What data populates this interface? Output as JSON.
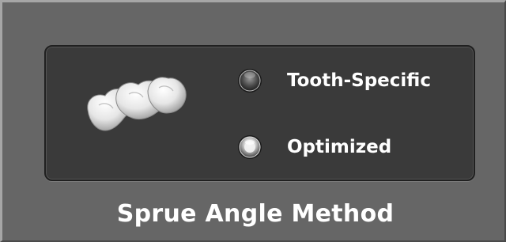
{
  "options": [
    {
      "label": "Tooth-Specific",
      "selected": false
    },
    {
      "label": "Optimized",
      "selected": true
    }
  ],
  "group_title": "Sprue Angle Method",
  "icon": "tooth-bridge-icon",
  "colors": {
    "frame": "#666666",
    "panel": "#3a3a3a",
    "text": "#ffffff"
  }
}
